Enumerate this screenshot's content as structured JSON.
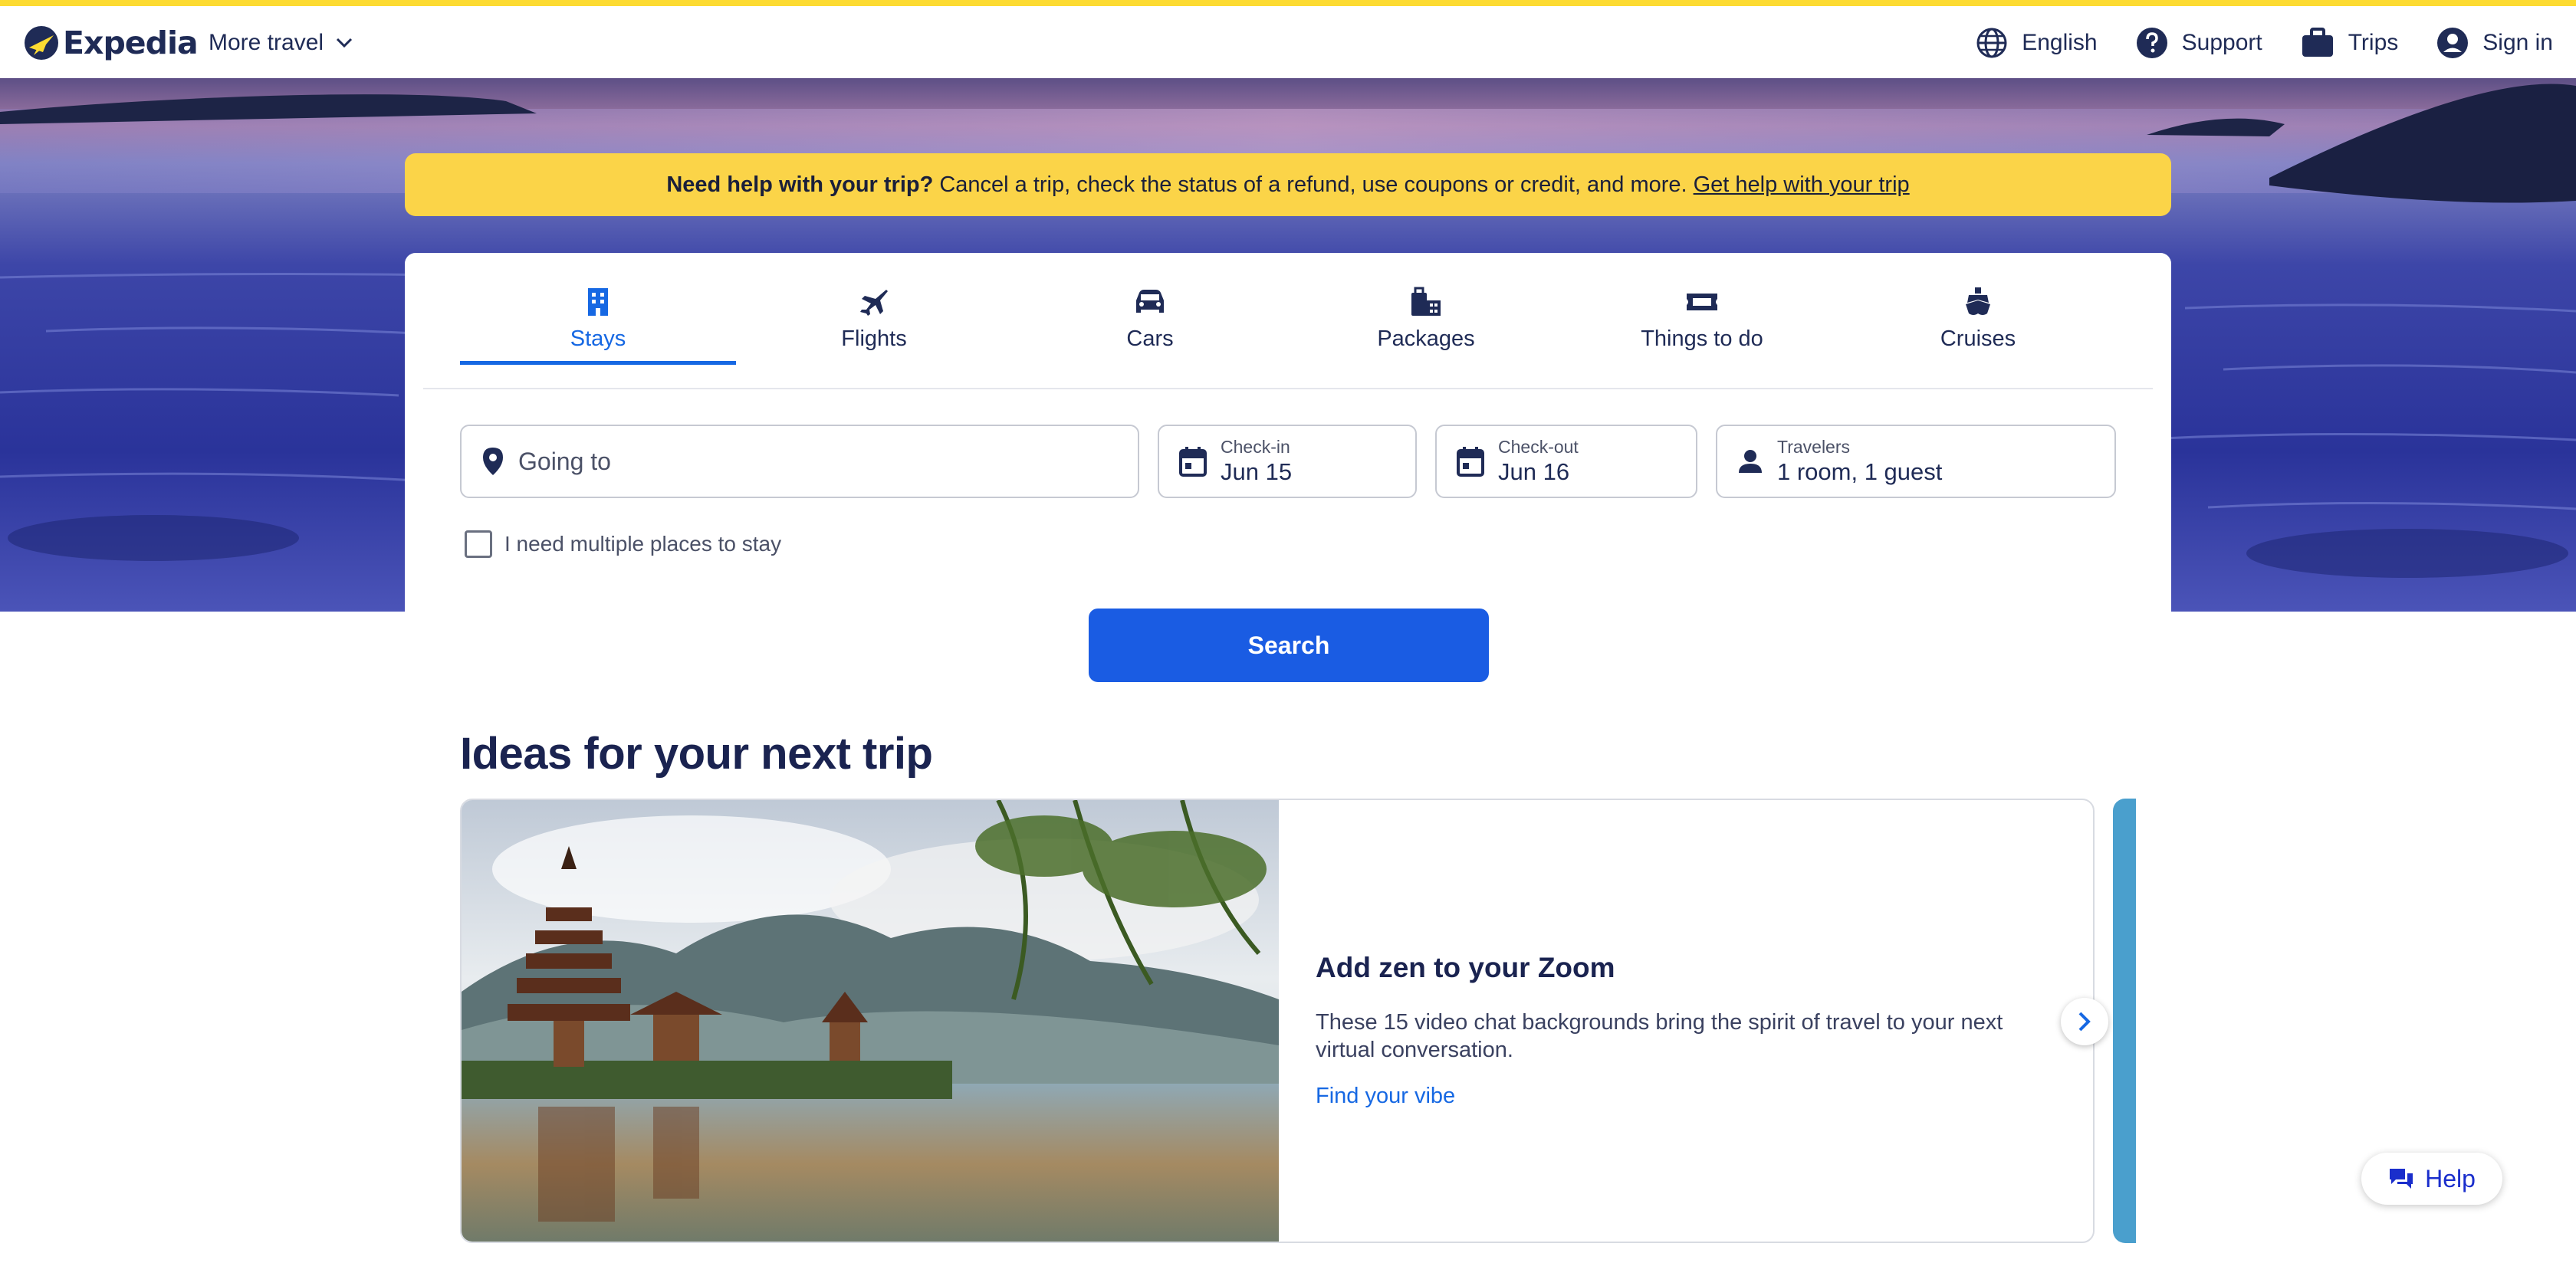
{
  "header": {
    "logo_text": "Expedia",
    "more_travel": "More travel",
    "nav": {
      "language": "English",
      "support": "Support",
      "trips": "Trips",
      "sign_in": "Sign in"
    }
  },
  "banner": {
    "bold": "Need help with your trip?",
    "text": "Cancel a trip, check the status of a refund, use coupons or credit, and more.",
    "link": "Get help with your trip"
  },
  "tabs": [
    {
      "label": "Stays",
      "icon": "building-icon",
      "active": true
    },
    {
      "label": "Flights",
      "icon": "plane-icon"
    },
    {
      "label": "Cars",
      "icon": "car-icon"
    },
    {
      "label": "Packages",
      "icon": "packages-icon"
    },
    {
      "label": "Things to do",
      "icon": "ticket-icon"
    },
    {
      "label": "Cruises",
      "icon": "ship-icon"
    }
  ],
  "search": {
    "going_to_placeholder": "Going to",
    "checkin_label": "Check-in",
    "checkin_value": "Jun 15",
    "checkout_label": "Check-out",
    "checkout_value": "Jun 16",
    "travelers_label": "Travelers",
    "travelers_value": "1 room, 1 guest",
    "multi_places": "I need multiple places to stay",
    "button": "Search"
  },
  "ideas": {
    "title": "Ideas for your next trip",
    "card": {
      "heading": "Add zen to your Zoom",
      "description": "These 15 video chat backgrounds bring the spirit of travel to your next virtual conversation.",
      "link": "Find your vibe"
    }
  },
  "help_button": "Help",
  "colors": {
    "brand_yellow": "#fddb32",
    "brand_navy": "#1f2b56",
    "primary_blue": "#1668e3",
    "search_button": "#1a5ce3"
  }
}
